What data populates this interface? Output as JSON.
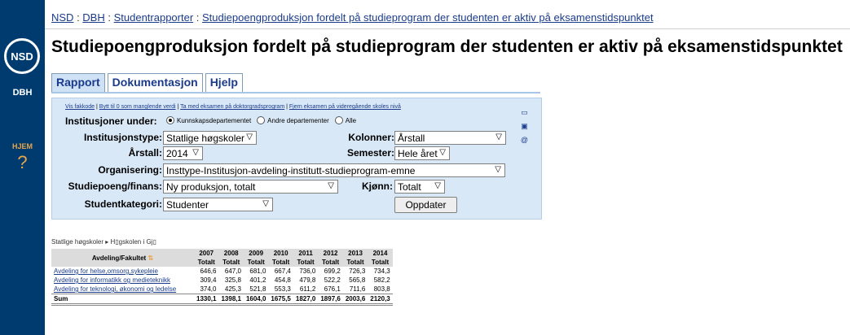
{
  "sidebar": {
    "logo": "NSD",
    "dbh": "DBH",
    "hjem": "HJEM",
    "help": "?"
  },
  "breadcrumb": {
    "items": [
      "NSD",
      "DBH",
      "Studentrapporter",
      "Studiepoengproduksjon fordelt på studieprogram der studenten er aktiv på eksamenstidspunktet"
    ],
    "sep": " : "
  },
  "page_title": "Studiepoengproduksjon fordelt på studieprogram der studenten er aktiv på eksamenstidspunktet",
  "tabs": [
    "Rapport",
    "Dokumentasjon",
    "Hjelp"
  ],
  "links": [
    "Vis fakkode",
    "Bytt til 0 som manglende verdi",
    "Ta med eksamen på doktorgradsprogram",
    "Fjern eksamen på videregående skoles nivå"
  ],
  "form": {
    "institusjoner_label": "Institusjoner under:",
    "radios": [
      "Kunnskapsdepartementet",
      "Andre departementer",
      "Alle"
    ],
    "institusjonstype_label": "Institusjonstype:",
    "institusjonstype_value": "Statlige høgskoler",
    "kolonner_label": "Kolonner:",
    "kolonner_value": "Årstall",
    "arstall_label": "Årstall:",
    "arstall_value": "2014",
    "semester_label": "Semester:",
    "semester_value": "Hele året",
    "organisering_label": "Organisering:",
    "organisering_value": "Insttype-Institusjon-avdeling-institutt-studieprogram-emne",
    "studiepoeng_label": "Studiepoeng/finans:",
    "studiepoeng_value": "Ny produksjon, totalt",
    "kjonn_label": "Kjønn:",
    "kjonn_value": "Totalt",
    "studentkategori_label": "Studentkategori:",
    "studentkategori_value": "Studenter",
    "submit_label": "Oppdater"
  },
  "result": {
    "crumb": "Statlige høgskoler ▸ H▯gskolen i Gj▯",
    "col_header": "Avdeling/Fakultet",
    "years": [
      "2007",
      "2008",
      "2009",
      "2010",
      "2011",
      "2012",
      "2013",
      "2014"
    ],
    "sub": "Totalt",
    "rows": [
      {
        "name": "Avdeling for helse,omsorg,sykepleie",
        "values": [
          "646,6",
          "647,0",
          "681,0",
          "667,4",
          "736,0",
          "699,2",
          "726,3",
          "734,3"
        ]
      },
      {
        "name": "Avdeling for informatikk og medieteknikk",
        "values": [
          "309,4",
          "325,8",
          "401,2",
          "454,8",
          "479,8",
          "522,2",
          "565,8",
          "582,2"
        ]
      },
      {
        "name": "Avdeling for teknologi, økonomi og ledelse",
        "values": [
          "374,0",
          "425,3",
          "521,8",
          "553,3",
          "611,2",
          "676,1",
          "711,6",
          "803,8"
        ]
      }
    ],
    "sum_label": "Sum",
    "sum_values": [
      "1330,1",
      "1398,1",
      "1604,0",
      "1675,5",
      "1827,0",
      "1897,6",
      "2003,6",
      "2120,3"
    ]
  }
}
